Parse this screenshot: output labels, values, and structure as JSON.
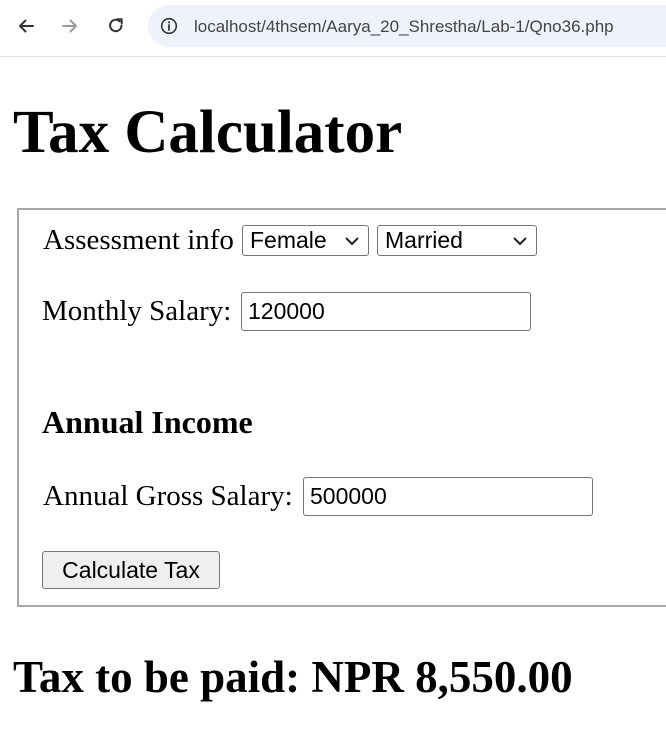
{
  "browser": {
    "url": "localhost/4thsem/Aarya_20_Shrestha/Lab-1/Qno36.php"
  },
  "page": {
    "title": "Tax Calculator",
    "form": {
      "assessment_label": "Assessment info",
      "gender_select": {
        "selected": "Female"
      },
      "marital_select": {
        "selected": "Married"
      },
      "monthly_salary_label": "Monthly Salary:",
      "monthly_salary_value": "120000",
      "annual_income_heading": "Annual Income",
      "annual_gross_label": "Annual Gross Salary:",
      "annual_gross_value": "500000",
      "calculate_button": "Calculate Tax"
    },
    "result": "Tax to be paid: NPR 8,550.00"
  }
}
